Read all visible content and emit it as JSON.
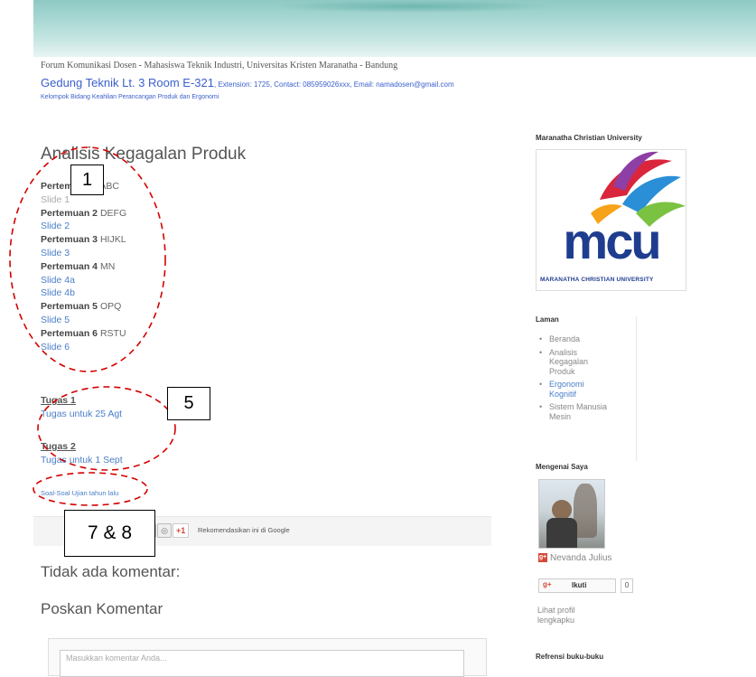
{
  "header": {
    "forum_line": "Forum Komunikasi Dosen - Mahasiswa Teknik Industri, Universitas Kristen Maranatha - Bandung",
    "location": "Gedung Teknik Lt. 3 Room E-321",
    "contact": ", Extension: 1725, Contact: 085959026xxx, Email: namadosen@gmail.com",
    "group": "Kelompok Bidang Keahlian Perancangan Produk dan Ergonomi"
  },
  "post": {
    "title": "Analisis Kegagalan Produk",
    "sessions": [
      {
        "label": "Pertemuan 1",
        "topic": "ABC",
        "slides": [
          "Slide 1"
        ]
      },
      {
        "label": "Pertemuan 2",
        "topic": "DEFG",
        "slides": [
          "Slide 2"
        ]
      },
      {
        "label": "Pertemuan 3",
        "topic": "HIJKL",
        "slides": [
          "Slide 3"
        ]
      },
      {
        "label": "Pertemuan 4",
        "topic": "MN",
        "slides": [
          "Slide 4a",
          "Slide 4b"
        ]
      },
      {
        "label": "Pertemuan 5",
        "topic": "OPQ",
        "slides": [
          "Slide 5"
        ]
      },
      {
        "label": "Pertemuan 6",
        "topic": "RSTU",
        "slides": [
          "Slide 6"
        ]
      }
    ],
    "tugas": [
      {
        "heading": "Tugas 1",
        "link": "Tugas untuk 25 Agt"
      },
      {
        "heading": "Tugas 2",
        "link": "Tugas untuk 1 Sept"
      }
    ],
    "soal_link": "Soal-Soal Ujian tahun lalu",
    "share": {
      "gplus_label": "+1",
      "recommend_text": "Rekomendasikan ini di Google"
    },
    "no_comments": "Tidak ada komentar:",
    "post_comment": "Poskan Komentar",
    "comment_placeholder": "Masukkan komentar Anda..."
  },
  "sidebar": {
    "university_title": "Maranatha Christian University",
    "logo_text": "mcu",
    "logo_tagline": "MARANATHA CHRISTIAN UNIVERSITY",
    "pages_title": "Laman",
    "pages": [
      "Beranda",
      "Analisis Kegagalan Produk",
      "Ergonomi Kognitif",
      "Sistem Manusia Mesin"
    ],
    "about_title": "Mengenai Saya",
    "profile_name": "Nevanda Julius",
    "follow_label": "Ikuti",
    "follow_count": "0",
    "view_profile": "Lihat profil lengkapku",
    "books_title": "Refrensi buku-buku"
  },
  "annotations": {
    "label_1": "1",
    "label_5": "5",
    "label_78": "7 & 8"
  },
  "colors": {
    "link": "#4a7ec8",
    "annotation_ellipse": "#d40000",
    "banner": "#a9d8d3"
  }
}
